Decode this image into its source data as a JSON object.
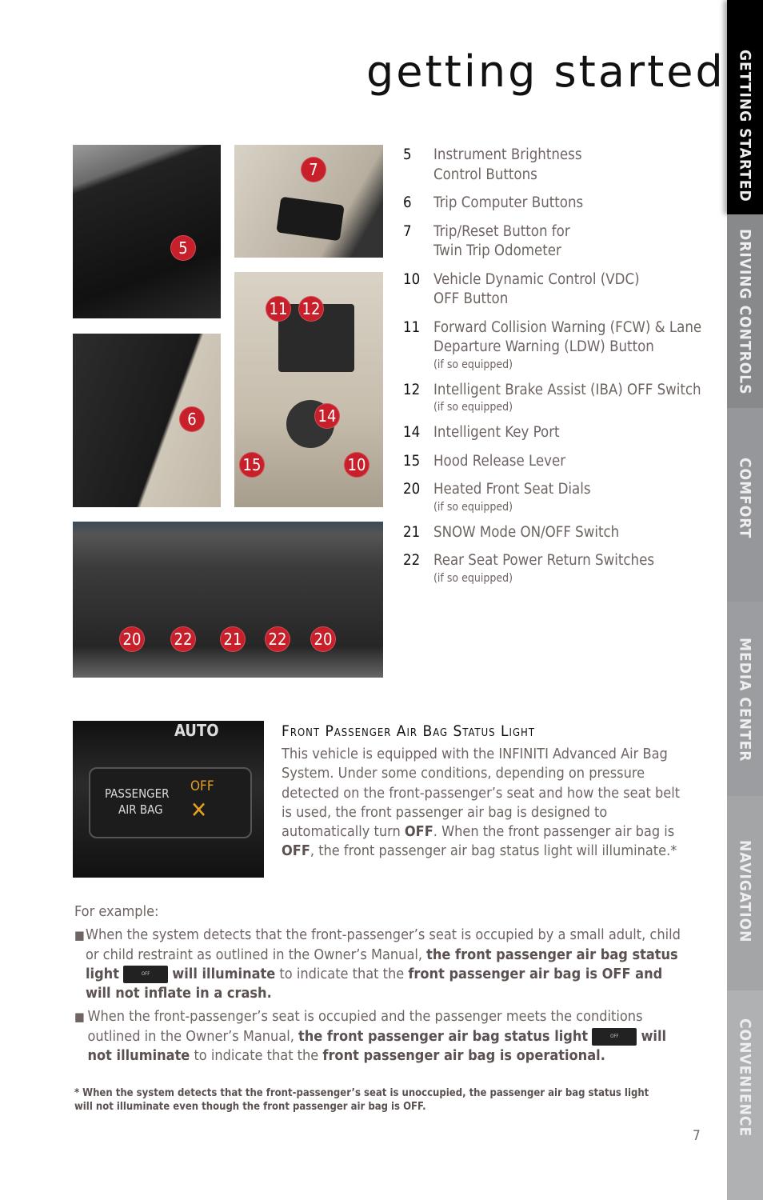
{
  "header": {
    "title": "getting started"
  },
  "tabs": [
    {
      "label": "GETTING STARTED",
      "color": "#000000",
      "active": true
    },
    {
      "label": "DRIVING CONTROLS",
      "color": "#88898b"
    },
    {
      "label": "COMFORT",
      "color": "#96979a"
    },
    {
      "label": "MEDIA CENTER",
      "color": "#9c9da0"
    },
    {
      "label": "NAVIGATION",
      "color": "#a4a5a7"
    },
    {
      "label": "CONVENIENCE",
      "color": "#b0b1b3"
    }
  ],
  "photos": {
    "badges": [
      "5",
      "7",
      "6",
      "11",
      "12",
      "14",
      "15",
      "10",
      "20",
      "22",
      "21",
      "22",
      "20"
    ],
    "airbag_auto": "AUTO",
    "airbag_passenger": "PASSENGER",
    "airbag_airbag": "AIR BAG",
    "airbag_off": "OFF"
  },
  "items": [
    {
      "num": "5",
      "label": "Instrument Brightness Control Buttons"
    },
    {
      "num": "6",
      "label": "Trip Computer Buttons"
    },
    {
      "num": "7",
      "label": "Trip/Reset Button for Twin Trip Odometer"
    },
    {
      "num": "10",
      "label": "Vehicle Dynamic Control (VDC) OFF Button"
    },
    {
      "num": "11",
      "label": "Forward Collision Warning (FCW) & Lane Departure Warning (LDW) Button",
      "note": "(if so equipped)"
    },
    {
      "num": "12",
      "label": "Intelligent Brake Assist (IBA) OFF Switch",
      "note": "(if so equipped)"
    },
    {
      "num": "14",
      "label": "Intelligent Key Port"
    },
    {
      "num": "15",
      "label": "Hood Release Lever"
    },
    {
      "num": "20",
      "label": "Heated Front Seat Dials",
      "note": "(if so equipped)"
    },
    {
      "num": "21",
      "label": "SNOW Mode ON/OFF Switch"
    },
    {
      "num": "22",
      "label": "Rear Seat Power Return Switches",
      "note": "(if so equipped)"
    }
  ],
  "airbag": {
    "heading": "Front Passenger Air Bag Status Light",
    "p1": "This vehicle is equipped with the INFINITI Advanced Air Bag System. Under some conditions, depending on pressure detected on the front-passenger’s seat and how the seat belt is used, the front passenger air bag is designed to automatically turn ",
    "off1": "OFF",
    "p2": ". When the front passenger air bag is ",
    "off2": "OFF",
    "p3": ", the front passenger air bag status light will illuminate.*"
  },
  "example": {
    "intro": "For example:",
    "b1": {
      "t1": "When the system detects that the front-passenger’s seat is occupied by a small adult, child or child restraint as outlined in the Owner’s Manual, ",
      "b1": "the front passenger air bag status light",
      "b2": "will illuminate",
      "t2": " to indicate that the ",
      "b3": "front passenger air bag is OFF and will not inflate in a crash."
    },
    "b2": {
      "t1": "When the front-passenger’s seat is occupied and the passenger meets the conditions outlined in the Owner’s Manual, ",
      "b1": "the front passenger air bag status light",
      "b2": "will not illuminate",
      "t2": " to indicate that the ",
      "b3": "front passenger air bag is operational."
    }
  },
  "footnote": "* When the system detects that the front-passenger’s seat is unoccupied, the passenger air bag status light will not illuminate even though the front passenger air bag is OFF.",
  "page_number": "7"
}
